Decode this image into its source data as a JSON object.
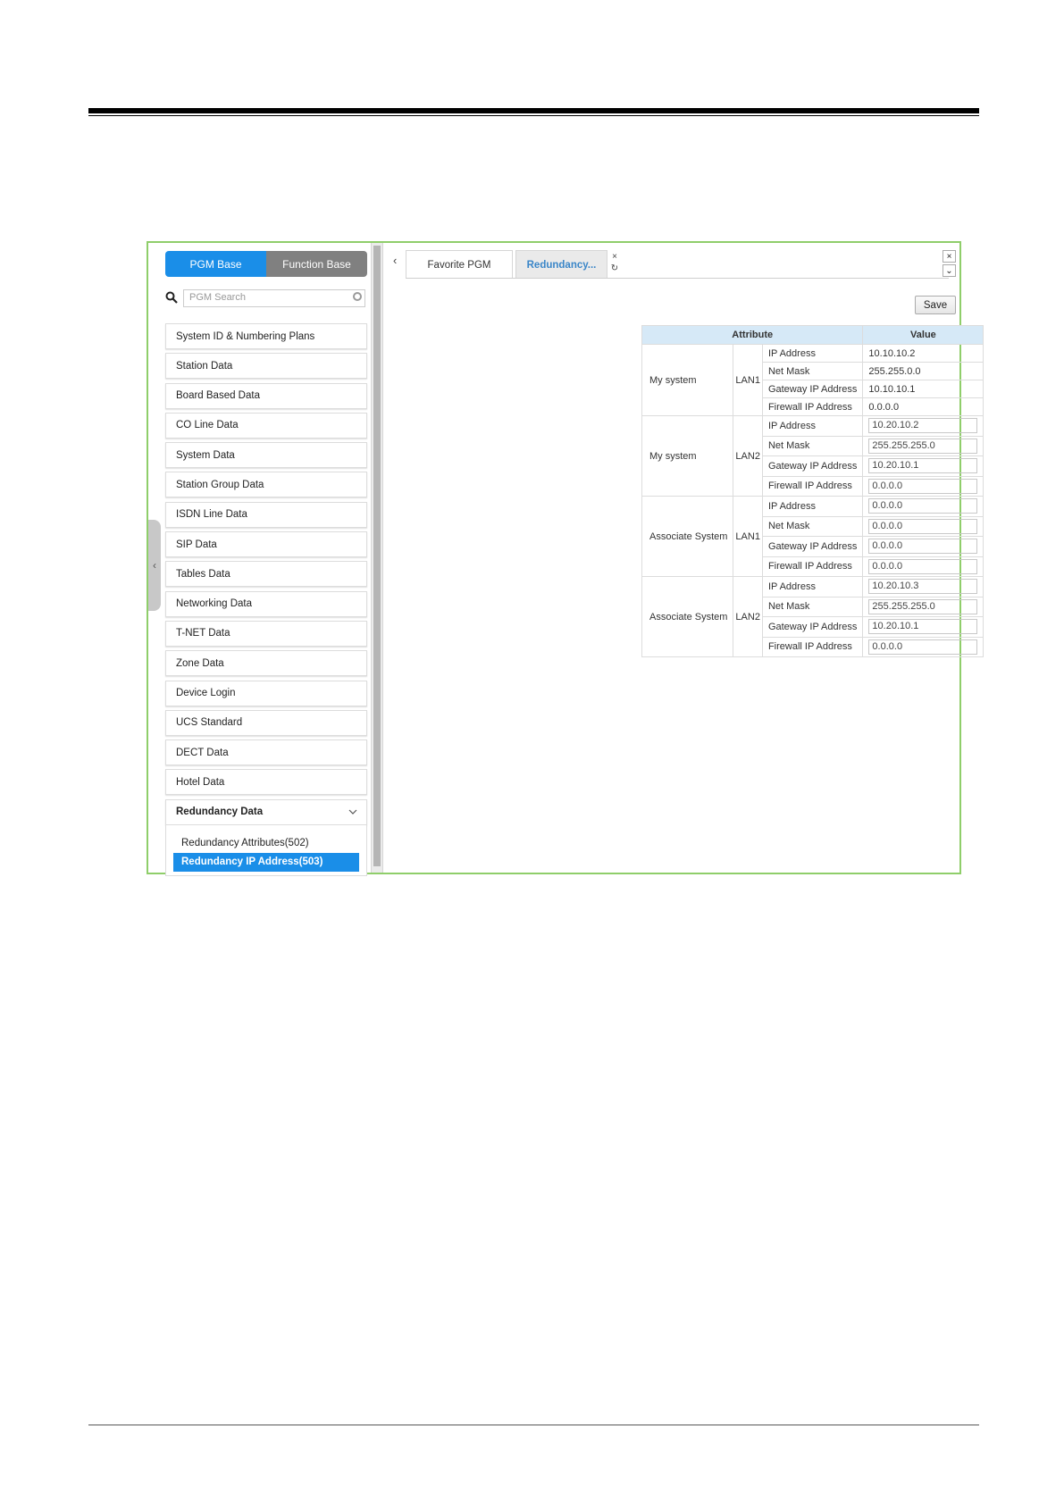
{
  "sidebar": {
    "toggle": {
      "pgm_base": "PGM Base",
      "function_base": "Function Base"
    },
    "search_placeholder": "PGM Search",
    "items": [
      "System ID & Numbering Plans",
      "Station Data",
      "Board Based Data",
      "CO Line Data",
      "System Data",
      "Station Group Data",
      "ISDN Line Data",
      "SIP Data",
      "Tables Data",
      "Networking Data",
      "T-NET Data",
      "Zone Data",
      "Device Login",
      "UCS Standard",
      "DECT Data",
      "Hotel Data"
    ],
    "open_item": "Redundancy Data",
    "sub_items": [
      "Redundancy Attributes(502)",
      "Redundancy IP Address(503)"
    ],
    "collapse_glyph": "‹"
  },
  "tabs": {
    "favorite": "Favorite PGM",
    "redundancy": "Redundancy...",
    "close_glyph": "×",
    "refresh_glyph": "↻",
    "prev_glyph": "‹"
  },
  "window": {
    "close_glyph": "×",
    "down_glyph": "⌄"
  },
  "save_label": "Save",
  "table": {
    "header_attribute": "Attribute",
    "header_value": "Value",
    "groups": [
      {
        "system": "My system",
        "lan": "LAN1",
        "editable": false,
        "rows": [
          {
            "label": "IP Address",
            "value": "10.10.10.2"
          },
          {
            "label": "Net Mask",
            "value": "255.255.0.0"
          },
          {
            "label": "Gateway IP Address",
            "value": "10.10.10.1"
          },
          {
            "label": "Firewall IP Address",
            "value": "0.0.0.0"
          }
        ]
      },
      {
        "system": "My system",
        "lan": "LAN2",
        "editable": true,
        "rows": [
          {
            "label": "IP Address",
            "value": "10.20.10.2"
          },
          {
            "label": "Net Mask",
            "value": "255.255.255.0"
          },
          {
            "label": "Gateway IP Address",
            "value": "10.20.10.1"
          },
          {
            "label": "Firewall IP Address",
            "value": "0.0.0.0"
          }
        ]
      },
      {
        "system": "Associate System",
        "lan": "LAN1",
        "editable": true,
        "rows": [
          {
            "label": "IP Address",
            "value": "0.0.0.0"
          },
          {
            "label": "Net Mask",
            "value": "0.0.0.0"
          },
          {
            "label": "Gateway IP Address",
            "value": "0.0.0.0"
          },
          {
            "label": "Firewall IP Address",
            "value": "0.0.0.0"
          }
        ]
      },
      {
        "system": "Associate System",
        "lan": "LAN2",
        "editable": true,
        "rows": [
          {
            "label": "IP Address",
            "value": "10.20.10.3"
          },
          {
            "label": "Net Mask",
            "value": "255.255.255.0"
          },
          {
            "label": "Gateway IP Address",
            "value": "10.20.10.1"
          },
          {
            "label": "Firewall IP Address",
            "value": "0.0.0.0"
          }
        ]
      }
    ]
  },
  "colors": {
    "accent": "#1a8ee8",
    "frame": "#8fce6a",
    "table_header": "#d6e9f7",
    "toggle_inactive": "#808080"
  }
}
